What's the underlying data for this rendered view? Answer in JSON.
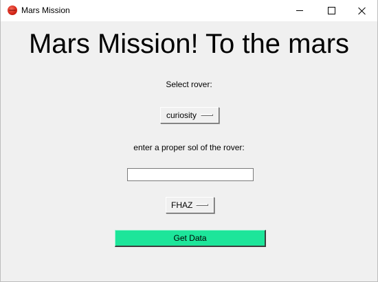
{
  "window": {
    "title": "Mars Mission",
    "icon": "mars-planet-icon",
    "controls": [
      "minimize-icon",
      "maximize-icon",
      "close-icon"
    ]
  },
  "main": {
    "heading": "Mars Mission! To the mars",
    "rover_label": "Select rover:",
    "rover_selected": "curiosity",
    "sol_label": "enter a proper sol of the rover:",
    "sol_value": "",
    "camera_selected": "FHAZ",
    "get_data_label": "Get Data"
  },
  "colors": {
    "window_bg": "#f0f0f0",
    "titlebar_bg": "#ffffff",
    "button_accent": "#1de59a"
  }
}
